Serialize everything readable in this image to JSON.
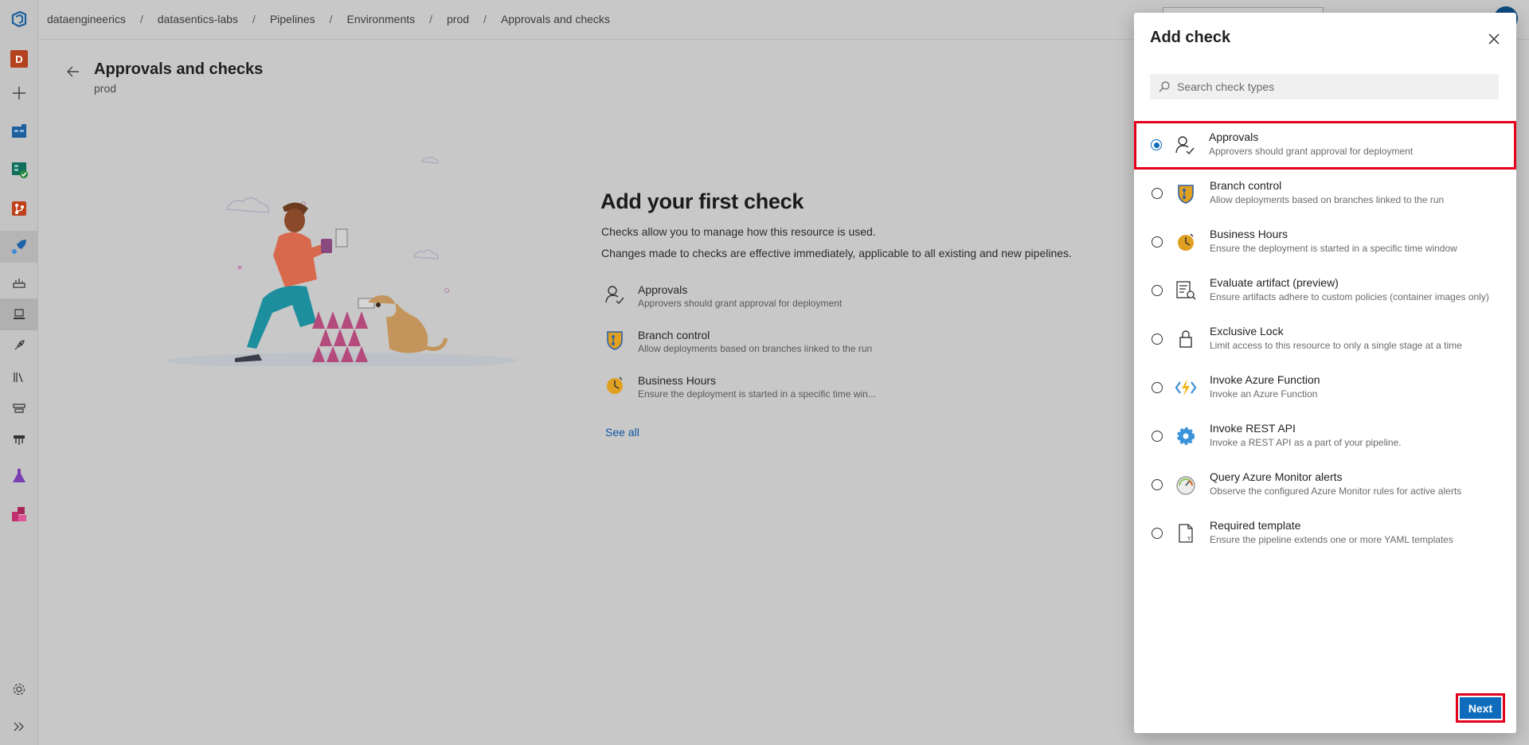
{
  "breadcrumb": [
    "dataengineerics",
    "datasentics-labs",
    "Pipelines",
    "Environments",
    "prod",
    "Approvals and checks"
  ],
  "nav": {
    "project_initial": "D",
    "items": [
      "azure-devops-logo-icon",
      "project-avatar",
      "new-item-icon",
      "overview-icon",
      "boards-icon",
      "repos-icon",
      "pipelines-icon",
      "pipelines-sub-icon",
      "environments-icon",
      "releases-icon",
      "library-icon",
      "task-groups-icon",
      "deployment-groups-icon",
      "test-plans-icon",
      "artifacts-icon",
      "settings-icon",
      "expand-icon"
    ]
  },
  "page": {
    "title": "Approvals and checks",
    "subtitle": "prod"
  },
  "empty_state": {
    "title": "Add your first check",
    "desc1": "Checks allow you to manage how this resource is used.",
    "desc2": "Changes made to checks are effective immediately, applicable to all existing and new pipelines.",
    "checks": [
      {
        "name": "Approvals",
        "desc": "Approvers should grant approval for deployment"
      },
      {
        "name": "Branch control",
        "desc": "Allow deployments based on branches linked to the run"
      },
      {
        "name": "Business Hours",
        "desc": "Ensure the deployment is started in a specific time win..."
      }
    ],
    "see_all": "See all"
  },
  "panel": {
    "title": "Add check",
    "search_placeholder": "Search check types",
    "selected_index": 0,
    "options": [
      {
        "name": "Approvals",
        "desc": "Approvers should grant approval for deployment"
      },
      {
        "name": "Branch control",
        "desc": "Allow deployments based on branches linked to the run"
      },
      {
        "name": "Business Hours",
        "desc": "Ensure the deployment is started in a specific time window"
      },
      {
        "name": "Evaluate artifact (preview)",
        "desc": "Ensure artifacts adhere to custom policies (container images only)"
      },
      {
        "name": "Exclusive Lock",
        "desc": "Limit access to this resource to only a single stage at a time"
      },
      {
        "name": "Invoke Azure Function",
        "desc": "Invoke an Azure Function"
      },
      {
        "name": "Invoke REST API",
        "desc": "Invoke a REST API as a part of your pipeline."
      },
      {
        "name": "Query Azure Monitor alerts",
        "desc": "Observe the configured Azure Monitor rules for active alerts"
      },
      {
        "name": "Required template",
        "desc": "Ensure the pipeline extends one or more YAML templates"
      }
    ],
    "next_label": "Next"
  },
  "colors": {
    "accent": "#0f6cbd",
    "highlight": "#e3001b",
    "overlay": "#c8c8c8"
  }
}
